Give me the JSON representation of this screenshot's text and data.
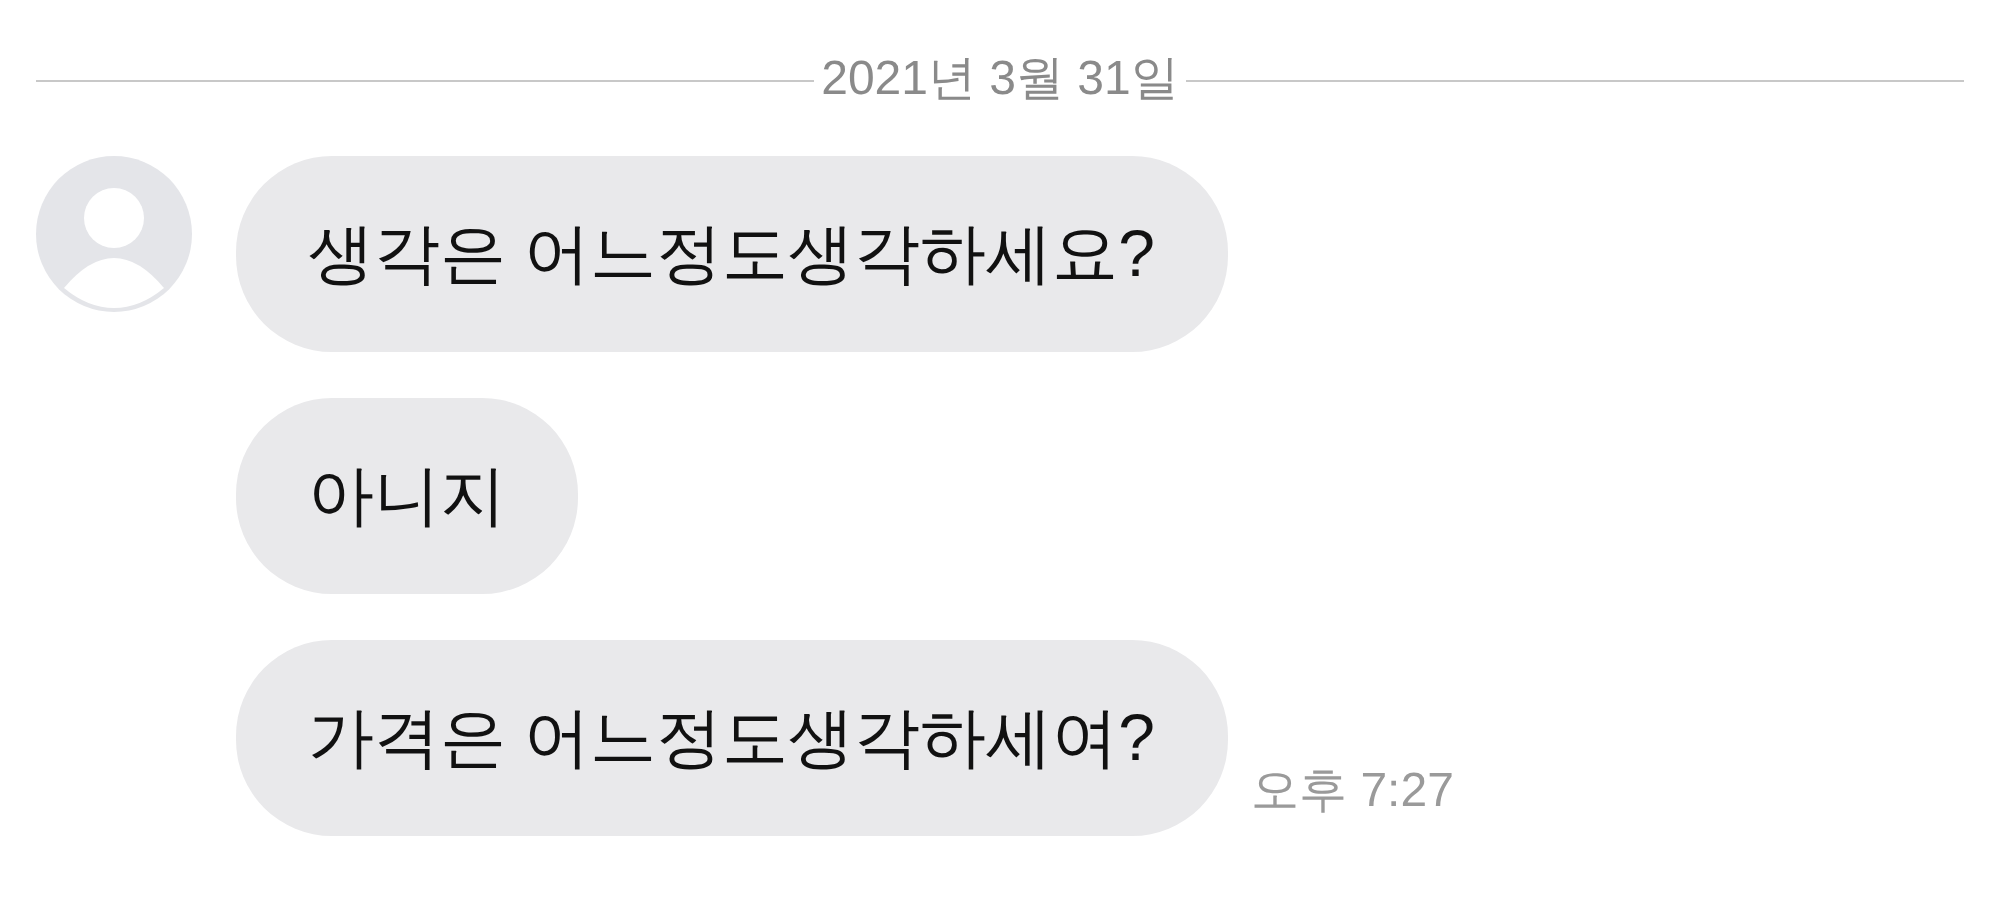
{
  "date_divider": "2021년 3월 31일",
  "messages": [
    {
      "text": "생각은 어느정도생각하세요?"
    },
    {
      "text": "아니지"
    },
    {
      "text": "가격은 어느정도생각하세여?",
      "time": "오후 7:27"
    }
  ]
}
